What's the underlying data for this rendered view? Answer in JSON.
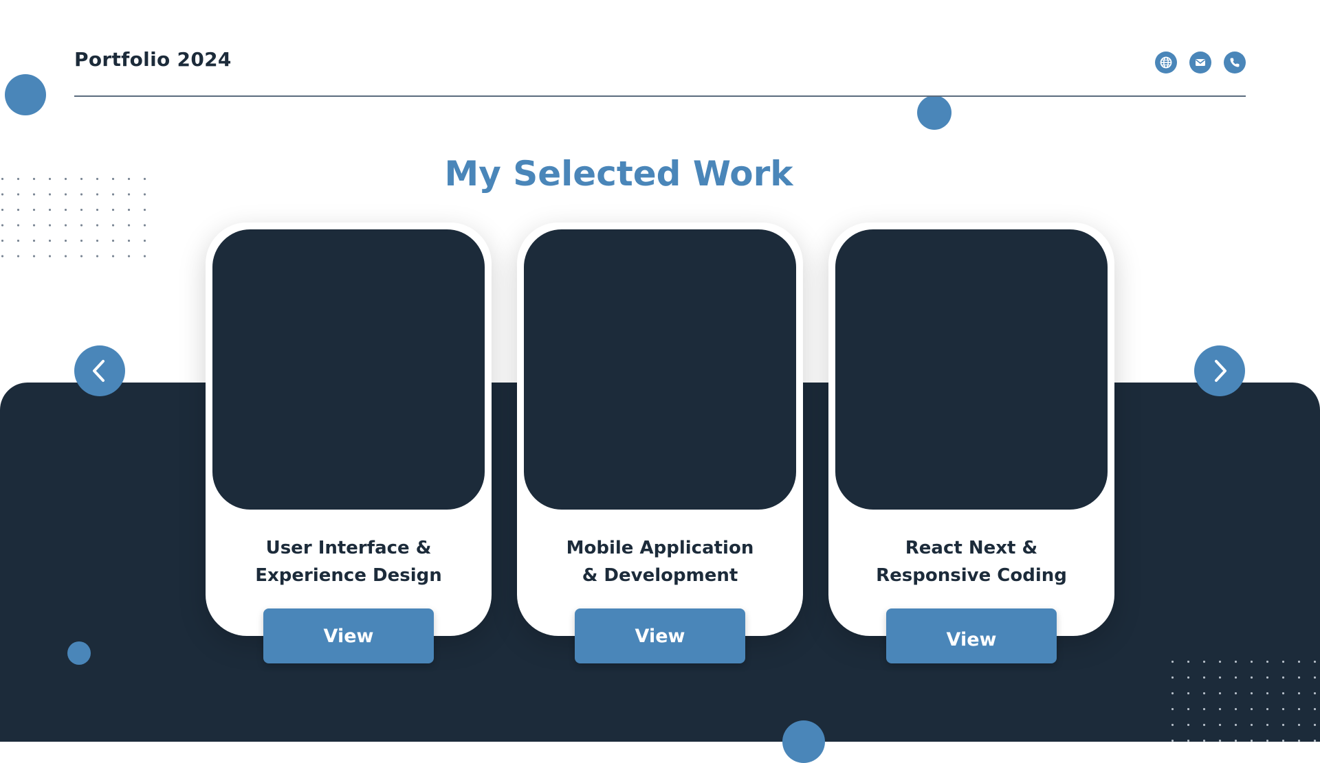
{
  "header": {
    "title": "Portfolio 2024",
    "icons": [
      "globe-icon",
      "mail-icon",
      "phone-icon"
    ]
  },
  "section": {
    "title": "My Selected Work"
  },
  "nav": {
    "prev_icon": "chevron-left-icon",
    "next_icon": "chevron-right-icon"
  },
  "cards": [
    {
      "line1": "User Interface &",
      "line2": "Experience Design",
      "button": "View"
    },
    {
      "line1": "Mobile Application",
      "line2": "& Development",
      "button": "View"
    },
    {
      "line1": "React Next &",
      "line2": "Responsive Coding",
      "button": "View"
    }
  ],
  "colors": {
    "accent": "#4a86b9",
    "dark": "#1c2b3a",
    "background": "#ffffff"
  }
}
